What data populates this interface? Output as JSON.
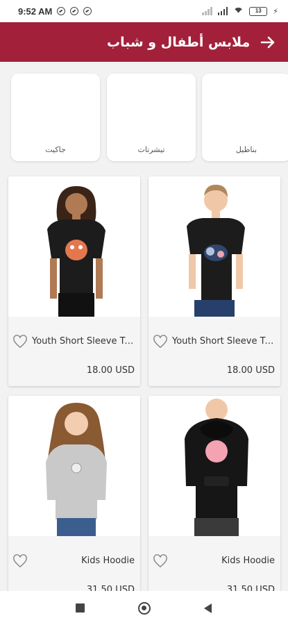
{
  "status_bar": {
    "time": "9:52 AM",
    "battery": "13"
  },
  "header": {
    "title": "ملابس أطفال و شباب",
    "back_icon": "arrow-right-icon"
  },
  "categories": [
    {
      "label": "بناطيل"
    },
    {
      "label": "تيشرتات"
    },
    {
      "label": "جاكيت"
    }
  ],
  "products": [
    {
      "name": "Youth Short Sleeve T-Shirt",
      "price": "18.00 USD",
      "icon": "heart-outline-icon"
    },
    {
      "name": "Youth Short Sleeve T-Shirt",
      "price": "18.00 USD",
      "icon": "heart-outline-icon"
    },
    {
      "name": "Kids Hoodie",
      "price": "31.50 USD",
      "icon": "heart-outline-icon"
    },
    {
      "name": "Kids Hoodie",
      "price": "31.50 USD",
      "icon": "heart-outline-icon"
    }
  ],
  "colors": {
    "brand": "#a3203a",
    "background": "#f2f2f2"
  }
}
